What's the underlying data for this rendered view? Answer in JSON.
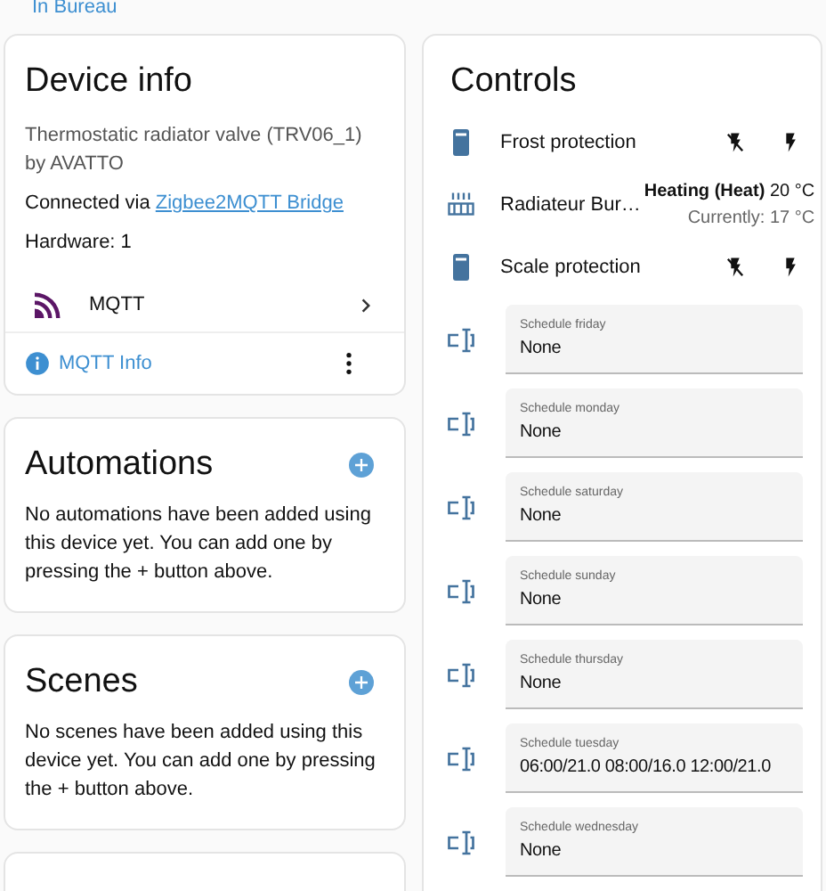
{
  "breadcrumb": "In Bureau",
  "device_info": {
    "title": "Device info",
    "model": "Thermostatic radiator valve (TRV06_1)",
    "manufacturer": "by AVATTO",
    "connected_prefix": "Connected via",
    "connected_link": "Zigbee2MQTT Bridge",
    "hardware": "Hardware: 1",
    "integration": "MQTT",
    "info_link": "MQTT Info"
  },
  "cards": [
    {
      "title": "Automations",
      "text": "No automations have been added using this device yet. You can add one by pressing the + button above."
    },
    {
      "title": "Scenes",
      "text": "No scenes have been added using this device yet. You can add one by pressing the + button above."
    }
  ],
  "controls": {
    "title": "Controls",
    "entities": [
      {
        "kind": "switch",
        "name": "Frost protection"
      },
      {
        "kind": "climate",
        "name": "Radiateur Bur…",
        "mode": "Heating (Heat)",
        "target": "20 °C",
        "current": "Currently: 17 °C"
      },
      {
        "kind": "switch",
        "name": "Scale protection"
      },
      {
        "kind": "text",
        "label": "Schedule friday",
        "value": "None"
      },
      {
        "kind": "text",
        "label": "Schedule monday",
        "value": "None"
      },
      {
        "kind": "text",
        "label": "Schedule saturday",
        "value": "None"
      },
      {
        "kind": "text",
        "label": "Schedule sunday",
        "value": "None"
      },
      {
        "kind": "text",
        "label": "Schedule thursday",
        "value": "None"
      },
      {
        "kind": "text",
        "label": "Schedule tuesday",
        "value": "06:00/21.0 08:00/16.0 12:00/21.0"
      },
      {
        "kind": "text",
        "label": "Schedule wednesday",
        "value": "None"
      }
    ]
  }
}
